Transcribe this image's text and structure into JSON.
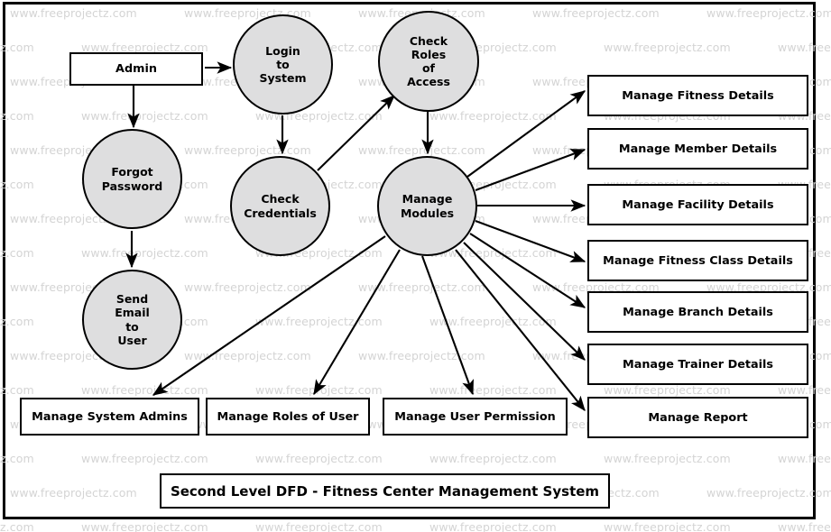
{
  "diagram": {
    "title": "Second Level DFD - Fitness Center Management System",
    "watermark_text": "www.freeprojectz.com",
    "colors": {
      "process_fill": "#dededf",
      "stroke": "#000000",
      "entity_fill": "#ffffff",
      "watermark": "#d4d4d4"
    },
    "external_entities": [
      {
        "id": "admin",
        "label": "Admin"
      }
    ],
    "processes": [
      {
        "id": "login",
        "label": "Login\nto\nSystem"
      },
      {
        "id": "checkroles",
        "label": "Check\nRoles\nof\nAccess"
      },
      {
        "id": "forgot",
        "label": "Forgot\nPassword"
      },
      {
        "id": "checkcred",
        "label": "Check\nCredentials"
      },
      {
        "id": "modules",
        "label": "Manage\nModules"
      },
      {
        "id": "sendemail",
        "label": "Send\nEmail\nto\nUser"
      }
    ],
    "data_stores_right": [
      {
        "id": "fitness",
        "label": "Manage Fitness Details"
      },
      {
        "id": "member",
        "label": "Manage Member Details"
      },
      {
        "id": "facility",
        "label": "Manage Facility Details"
      },
      {
        "id": "fitnessclass",
        "label": "Manage Fitness Class Details"
      },
      {
        "id": "branch",
        "label": "Manage Branch Details"
      },
      {
        "id": "trainer",
        "label": "Manage Trainer Details"
      },
      {
        "id": "report",
        "label": "Manage Report"
      }
    ],
    "data_stores_bottom": [
      {
        "id": "sysadmins",
        "label": "Manage System Admins"
      },
      {
        "id": "roles",
        "label": "Manage Roles of User"
      },
      {
        "id": "permission",
        "label": "Manage User Permission"
      }
    ],
    "flows": [
      {
        "from": "admin",
        "to": "login"
      },
      {
        "from": "admin",
        "to": "forgot"
      },
      {
        "from": "login",
        "to": "checkcred"
      },
      {
        "from": "forgot",
        "to": "sendemail"
      },
      {
        "from": "checkcred",
        "to": "checkroles"
      },
      {
        "from": "checkroles",
        "to": "modules"
      },
      {
        "from": "modules",
        "to": "fitness"
      },
      {
        "from": "modules",
        "to": "member"
      },
      {
        "from": "modules",
        "to": "facility"
      },
      {
        "from": "modules",
        "to": "fitnessclass"
      },
      {
        "from": "modules",
        "to": "branch"
      },
      {
        "from": "modules",
        "to": "trainer"
      },
      {
        "from": "modules",
        "to": "report"
      },
      {
        "from": "modules",
        "to": "sysadmins"
      },
      {
        "from": "modules",
        "to": "roles"
      },
      {
        "from": "modules",
        "to": "permission"
      }
    ]
  }
}
